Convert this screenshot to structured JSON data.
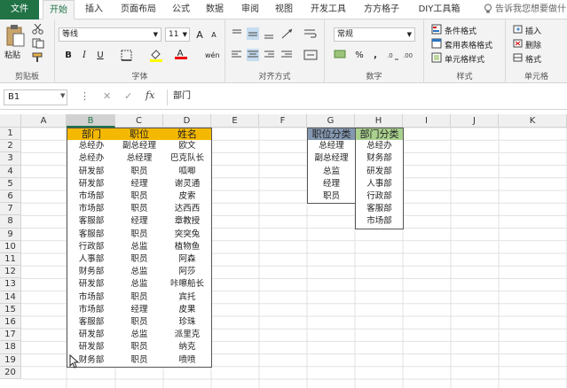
{
  "tabs": [
    "文件",
    "开始",
    "插入",
    "页面布局",
    "公式",
    "数据",
    "审阅",
    "视图",
    "开发工具",
    "方方格子",
    "DIY工具箱"
  ],
  "tell_me": "告诉我您想要做什么...",
  "ribbon": {
    "clipboard": {
      "paste": "粘贴",
      "label": "剪贴板"
    },
    "font": {
      "name": "等线",
      "size": "11",
      "bold": "B",
      "italic": "I",
      "underline": "U",
      "grow": "A",
      "shrink": "A",
      "color_letter": "A",
      "wen": "wén",
      "label": "字体"
    },
    "align": {
      "label": "对齐方式"
    },
    "number": {
      "format": "常规",
      "percent": "%",
      "comma": ",",
      "label": "数字"
    },
    "styles": {
      "cond": "条件格式",
      "table": "套用表格格式",
      "cell": "单元格样式",
      "label": "样式"
    },
    "cells": {
      "insert": "插入",
      "delete": "删除",
      "format": "格式",
      "label": "单元格"
    }
  },
  "formula_bar": {
    "name_box": "B1",
    "fx": "fx",
    "cancel": "✕",
    "enter": "✓",
    "value": "部门"
  },
  "columns": [
    "A",
    "B",
    "C",
    "D",
    "E",
    "F",
    "G",
    "H",
    "I",
    "J",
    "K"
  ],
  "rows": [
    "1",
    "2",
    "3",
    "4",
    "5",
    "6",
    "7",
    "8",
    "9",
    "10",
    "11",
    "12",
    "13",
    "14",
    "15",
    "16",
    "17",
    "18",
    "19",
    "20"
  ],
  "table1": {
    "headers": [
      "部门",
      "职位",
      "姓名"
    ],
    "rows": [
      [
        "总经办",
        "副总经理",
        "欧文"
      ],
      [
        "总经办",
        "总经理",
        "巴克队长"
      ],
      [
        "研发部",
        "职员",
        "呱唧"
      ],
      [
        "研发部",
        "经理",
        "谢灵通"
      ],
      [
        "市场部",
        "职员",
        "皮索"
      ],
      [
        "市场部",
        "职员",
        "达西西"
      ],
      [
        "客服部",
        "经理",
        "章教授"
      ],
      [
        "客服部",
        "职员",
        "突突兔"
      ],
      [
        "行政部",
        "总监",
        "植物鱼"
      ],
      [
        "人事部",
        "职员",
        "阿森"
      ],
      [
        "财务部",
        "总监",
        "阿莎"
      ],
      [
        "研发部",
        "总监",
        "咔嚓船长"
      ],
      [
        "市场部",
        "职员",
        "宾托"
      ],
      [
        "市场部",
        "经理",
        "皮果"
      ],
      [
        "客服部",
        "职员",
        "珍珠"
      ],
      [
        "研发部",
        "总监",
        "派里克"
      ],
      [
        "研发部",
        "职员",
        "纳克"
      ],
      [
        "财务部",
        "职员",
        "喷喷"
      ]
    ]
  },
  "position_list": {
    "header": "职位分类",
    "items": [
      "总经理",
      "副总经理",
      "总监",
      "经理",
      "职员"
    ]
  },
  "dept_list": {
    "header": "部门分类",
    "items": [
      "总经办",
      "财务部",
      "研发部",
      "人事部",
      "行政部",
      "客服部",
      "市场部"
    ]
  },
  "colors": {
    "orange": "#f5b800",
    "blue": "#8497b0",
    "green": "#a9d08e",
    "excel_green": "#217346"
  }
}
